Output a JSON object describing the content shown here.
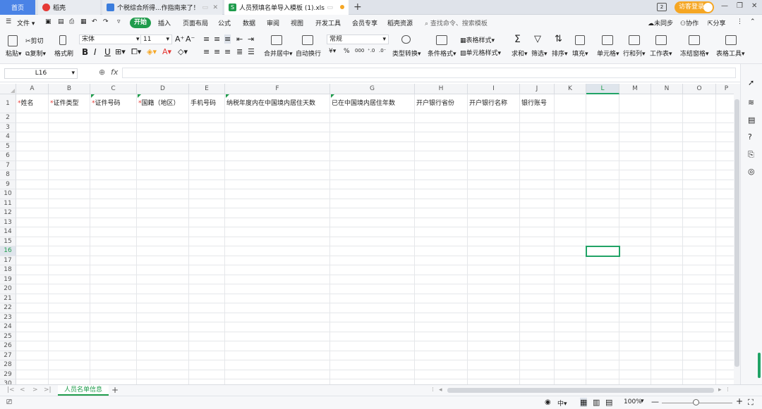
{
  "tabs": {
    "home": "首页",
    "t1": "稻壳",
    "t2": "个税综合所得...作指南来了！",
    "t3": "人员预填名单导入模板 (1).xls"
  },
  "header": {
    "login": "访客登录"
  },
  "menu": {
    "file": "文件",
    "start": "开始",
    "items": [
      "插入",
      "页面布局",
      "公式",
      "数据",
      "审阅",
      "视图",
      "开发工具",
      "会员专享",
      "稻壳资源"
    ],
    "search": "查找命令、搜索模板",
    "sync": "未同步",
    "collab": "协作",
    "share": "分享"
  },
  "ribbon": {
    "cut": "剪切",
    "paste": "粘贴",
    "copy": "复制",
    "format_painter": "格式刷",
    "font": "宋体",
    "size": "11",
    "merge": "合并居中",
    "wrap": "自动换行",
    "number_format": "常规",
    "convert": "类型转换",
    "cond_format": "条件格式",
    "table_style": "表格样式",
    "cell_style": "单元格样式",
    "sum": "求和",
    "filter": "筛选",
    "sort": "排序",
    "fill": "填充",
    "cells": "单元格",
    "rowcol": "行和列",
    "sheet": "工作表",
    "freeze": "冻结窗格",
    "tools": "表格工具"
  },
  "formula": {
    "cell_ref": "L16",
    "fx": "fx",
    "value": ""
  },
  "columns": [
    "A",
    "B",
    "C",
    "D",
    "E",
    "F",
    "G",
    "H",
    "I",
    "J",
    "K",
    "L",
    "M",
    "N",
    "O",
    "P"
  ],
  "headers": [
    "*",
    "姓名",
    "*",
    "证件类型",
    "*",
    "证件号码",
    "*",
    "国籍（地区）",
    "手机号码",
    "纳税年度内在中国境内居住天数",
    "已在中国境内居住年数",
    "开户银行省份",
    "开户银行名称",
    "银行账号"
  ],
  "rows": [
    "1",
    "2",
    "3",
    "4",
    "5",
    "6",
    "7",
    "8",
    "9",
    "10",
    "11",
    "12",
    "13",
    "14",
    "15",
    "16",
    "17",
    "18",
    "19",
    "20",
    "21",
    "22",
    "23",
    "24",
    "25",
    "26",
    "27",
    "28",
    "29",
    "30"
  ],
  "sheet": {
    "name": "人员名单信息"
  },
  "status": {
    "zoom": "100%",
    "lang": "中"
  },
  "colors": {
    "accent": "#1f9c4c",
    "selection": "#21a366",
    "required": "#e53935"
  }
}
